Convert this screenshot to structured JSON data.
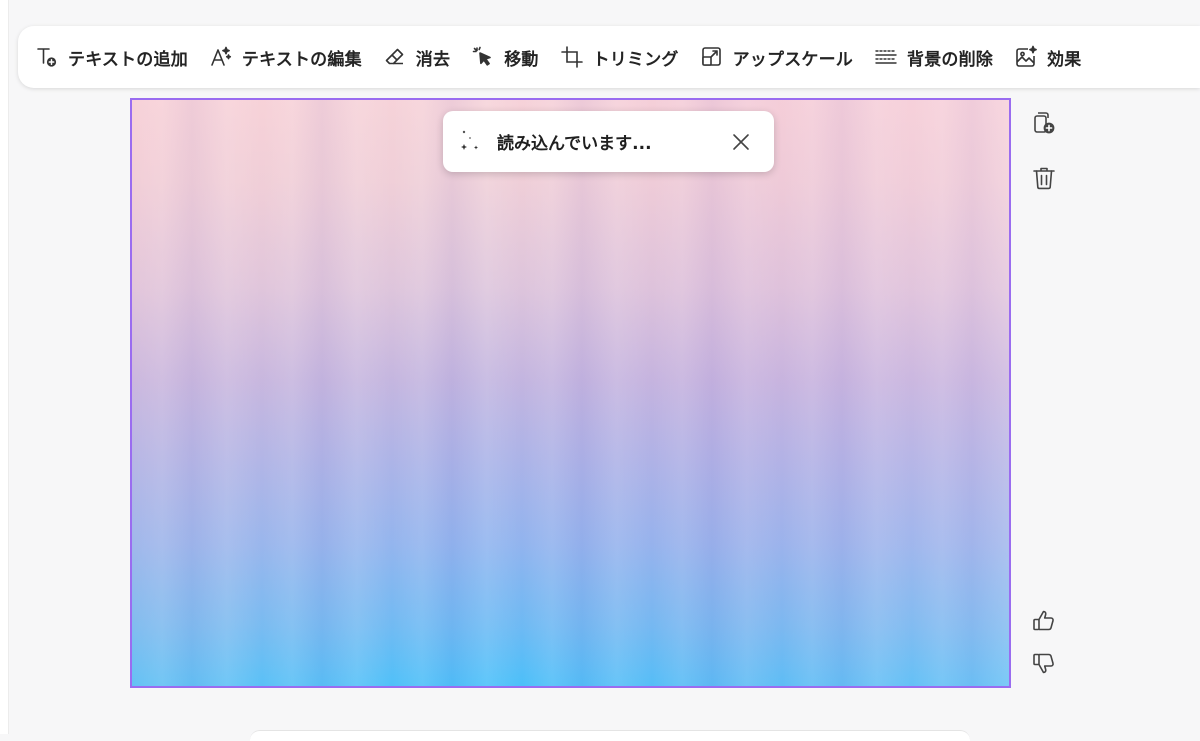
{
  "toolbar": {
    "items": [
      {
        "id": "add-text",
        "label": "テキストの追加",
        "icon": "text-add-icon"
      },
      {
        "id": "edit-text",
        "label": "テキストの編集",
        "icon": "text-sparkle-icon"
      },
      {
        "id": "erase",
        "label": "消去",
        "icon": "eraser-icon"
      },
      {
        "id": "move",
        "label": "移動",
        "icon": "cursor-click-icon"
      },
      {
        "id": "crop",
        "label": "トリミング",
        "icon": "crop-icon"
      },
      {
        "id": "upscale",
        "label": "アップスケール",
        "icon": "upscale-icon"
      },
      {
        "id": "remove-background",
        "label": "背景の削除",
        "icon": "background-remove-icon"
      },
      {
        "id": "effects",
        "label": "効果",
        "icon": "image-sparkle-icon"
      }
    ]
  },
  "toast": {
    "text": "読み込んでいます...",
    "icon": "loading-sparkle-icon",
    "close_icon": "close-icon"
  },
  "side_actions": {
    "icons": [
      "copy-add-icon",
      "trash-icon",
      "thumbs-up-icon",
      "thumbs-down-icon"
    ]
  },
  "colors": {
    "canvas_border": "#9a6cf0",
    "gradient_top": "#f6d3d9",
    "gradient_middle": "#c2b5e0",
    "gradient_bottom": "#49c0fa"
  }
}
